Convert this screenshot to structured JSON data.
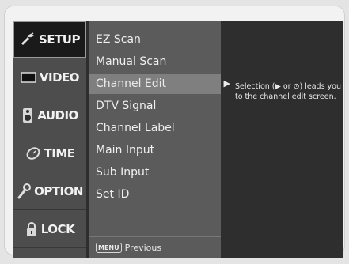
{
  "menu": {
    "items": [
      {
        "label": "SETUP",
        "icon": "satellite-icon"
      },
      {
        "label": "VIDEO",
        "icon": "tv-screen-icon"
      },
      {
        "label": "AUDIO",
        "icon": "speaker-icon"
      },
      {
        "label": "TIME",
        "icon": "clock-icon"
      },
      {
        "label": "OPTION",
        "icon": "wrench-icon"
      },
      {
        "label": "LOCK",
        "icon": "padlock-icon"
      }
    ],
    "active_index": 0
  },
  "submenu": {
    "items": [
      "EZ Scan",
      "Manual Scan",
      "Channel Edit",
      "DTV Signal",
      "Channel Label",
      "Main Input",
      "Sub Input",
      "Set ID"
    ],
    "selected_index": 2,
    "footer_key": "MENU",
    "footer_label": "Previous"
  },
  "help": {
    "text": "Selection (▶ or ⊙) leads you to the channel edit screen."
  },
  "colors": {
    "panel": "#2e2e2e",
    "menu_bg": "#4d4d4d",
    "submenu_bg": "#5b5b5b",
    "selected_bg": "#7f7f7f"
  }
}
